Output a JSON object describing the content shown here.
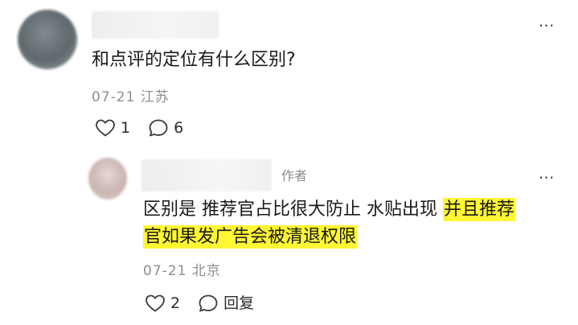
{
  "comment": {
    "text": "和点评的定位有什么区别?",
    "date": "07-21",
    "location": "江苏",
    "like_count": "1",
    "reply_count": "6",
    "more_icon": "more-icon"
  },
  "reply": {
    "author_tag": "作者",
    "line1_plain": "区别是 推荐官占比很大防止 水贴出现 ",
    "line1_highlight": "并且推荐",
    "line2_highlight": "官如果发广告会被清退权限",
    "date": "07-21",
    "location": "北京",
    "like_count": "2",
    "reply_label": "回复",
    "highlight_color": "#fff733"
  }
}
